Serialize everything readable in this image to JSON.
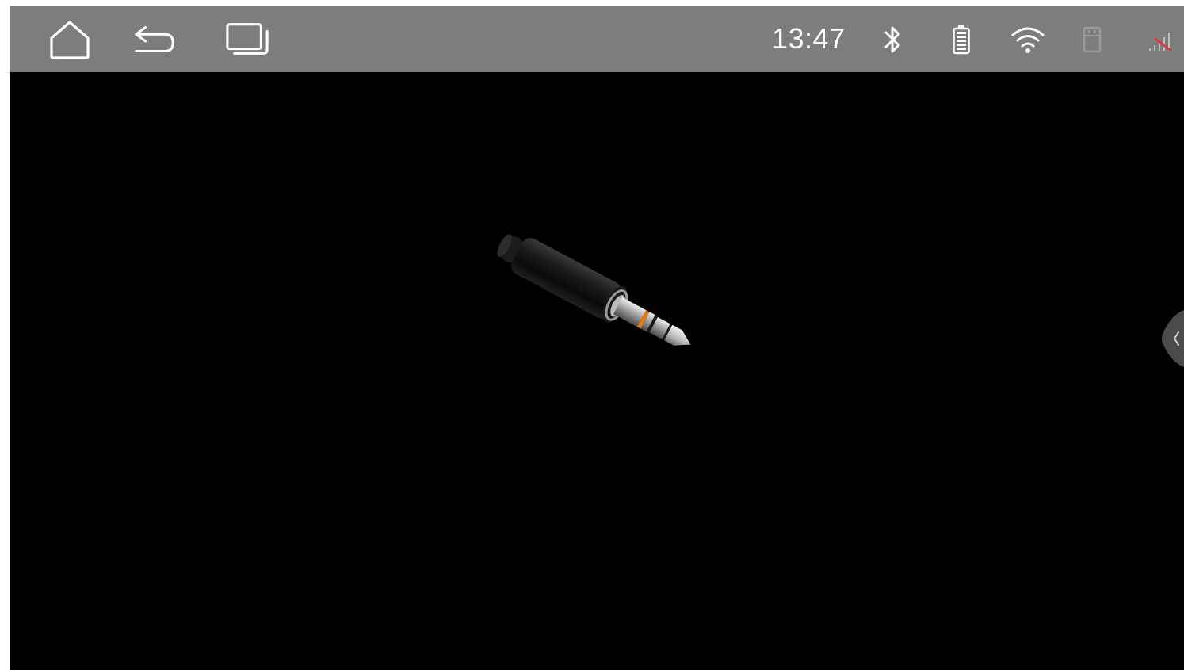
{
  "status_bar": {
    "time": "13:47",
    "icons": [
      "bluetooth-icon",
      "battery-icon",
      "wifi-icon",
      "sd-card-icon",
      "signal-icon"
    ]
  },
  "navigation": {
    "buttons": [
      "home-icon",
      "back-icon",
      "recents-icon"
    ]
  },
  "content": {
    "graphic": "audio-jack-icon",
    "side_panel_toggle": "chevron-left-icon"
  },
  "colors": {
    "status_bar_bg": "#7d7d7d",
    "screen_bg": "#000000",
    "icon": "#ffffff",
    "signal_off": "#e0323c"
  }
}
